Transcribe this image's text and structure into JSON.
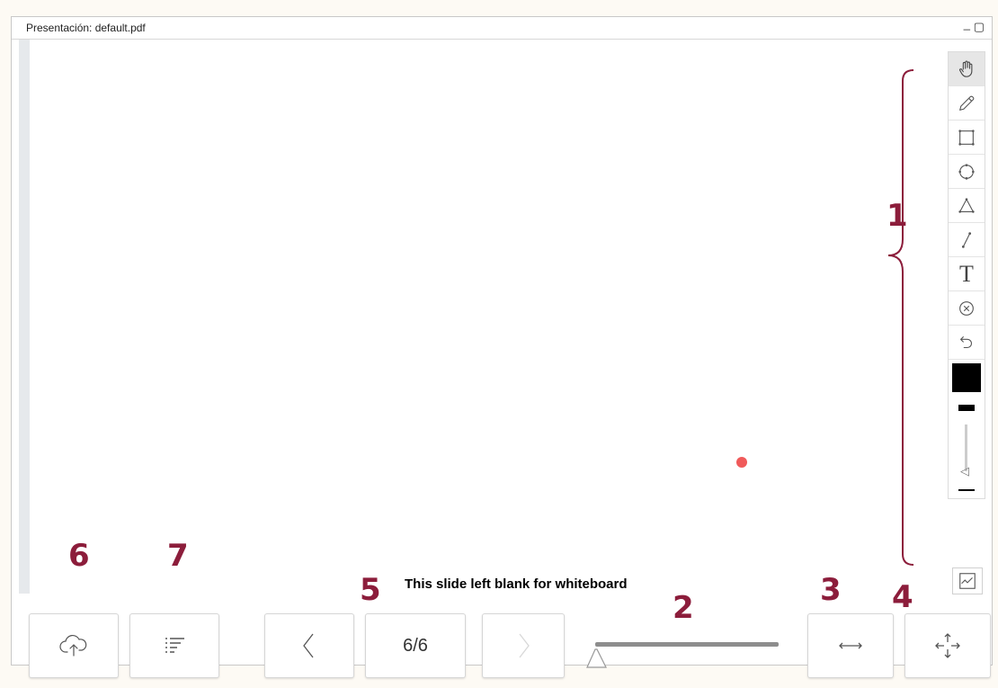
{
  "window": {
    "title": "Presentación: default.pdf",
    "minimize_label": "_",
    "maximize_label": "▢"
  },
  "slide": {
    "caption": "This slide left blank for whiteboard"
  },
  "tools": [
    {
      "name": "hand-tool",
      "icon": "hand-icon",
      "active": true
    },
    {
      "name": "pencil-tool",
      "icon": "pencil-icon"
    },
    {
      "name": "rectangle-tool",
      "icon": "rectangle-icon"
    },
    {
      "name": "ellipse-tool",
      "icon": "ellipse-icon"
    },
    {
      "name": "triangle-tool",
      "icon": "triangle-icon"
    },
    {
      "name": "line-tool",
      "icon": "line-icon"
    },
    {
      "name": "text-tool",
      "icon": "text-icon",
      "label": "T"
    },
    {
      "name": "clear-tool",
      "icon": "clear-icon"
    },
    {
      "name": "undo-tool",
      "icon": "undo-icon"
    }
  ],
  "colors": {
    "drawing_color": "#000000",
    "annotation": "#8c1d3b",
    "pointer": "#f05a5a"
  },
  "annotations": {
    "n1": "1",
    "n2": "2",
    "n3": "3",
    "n4": "4",
    "n5": "5",
    "n6": "6",
    "n7": "7"
  },
  "navigation": {
    "page_label": "6/6",
    "prev_icon": "chevron-left-icon",
    "next_icon": "chevron-right-icon"
  },
  "bottom_buttons": {
    "upload_icon": "cloud-upload-icon",
    "list_icon": "list-icon",
    "fit_width_icon": "fit-width-icon",
    "fit_page_icon": "move-arrows-icon"
  }
}
